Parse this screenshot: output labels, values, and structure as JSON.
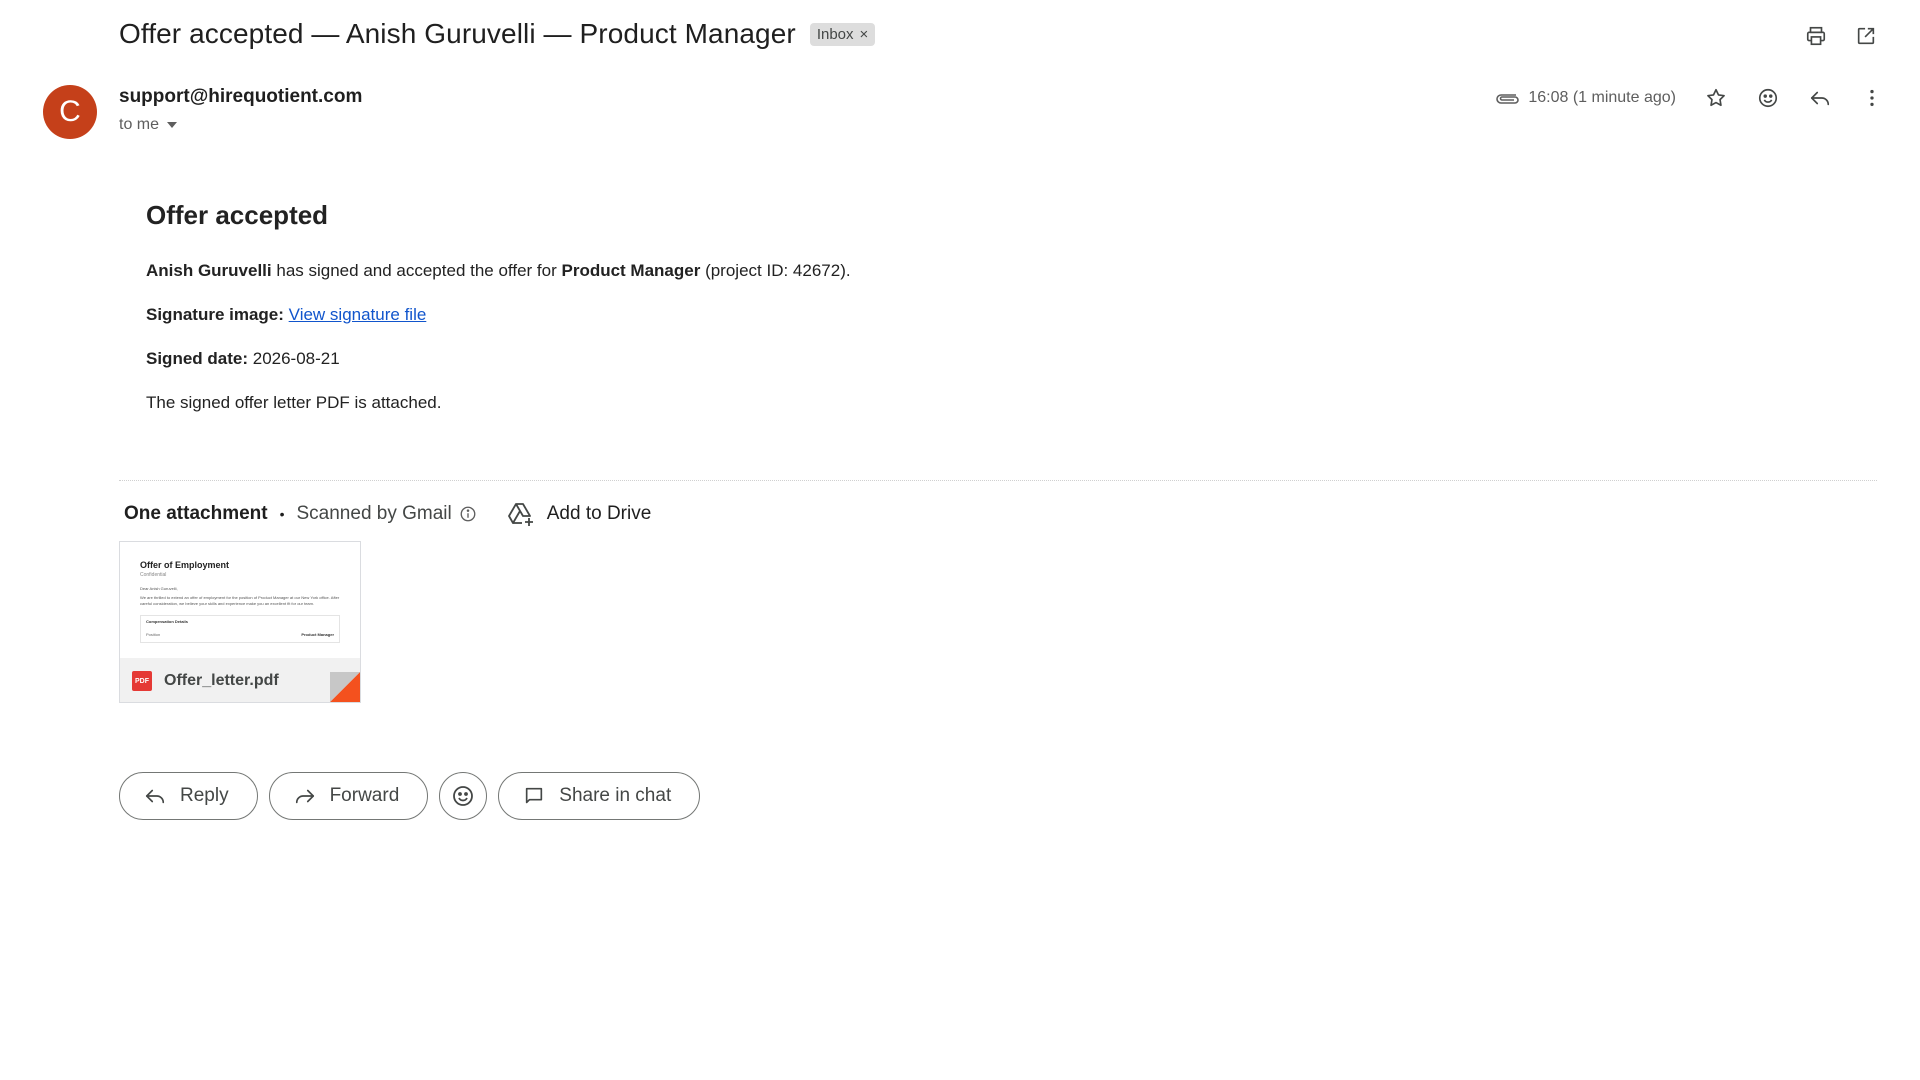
{
  "email": {
    "subject": "Offer accepted — Anish Guruvelli — Product Manager",
    "label": "Inbox",
    "label_remove": "×",
    "avatar_letter": "C",
    "avatar_color": "#c5401a",
    "sender": "support@hirequotient.com",
    "recipient": "to me",
    "timestamp": "16:08 (1 minute ago)"
  },
  "body": {
    "heading": "Offer accepted",
    "candidate": "Anish Guruvelli",
    "line1_mid": " has signed and accepted the offer for ",
    "role": "Product Manager",
    "line1_end": " (project ID: 42672).",
    "signature_label": "Signature image:",
    "signature_link": "View signature file",
    "date_label": "Signed date:",
    "date_value": " 2026-08-21",
    "closing": "The signed offer letter PDF is attached."
  },
  "attachments": {
    "count_label": "One attachment",
    "separator": "•",
    "scanned": "Scanned by Gmail",
    "add_to_drive": "Add to Drive",
    "file_name": "Offer_letter.pdf",
    "file_type": "PDF",
    "preview": {
      "title": "Offer of Employment",
      "subtitle": "Confidential",
      "greeting": "Dear Anish Guruvelli,",
      "text": "We are thrilled to extend an offer of employment for the position of Product Manager at our New York office. After careful consideration, we believe your skills and experience make you an excellent fit for our team.",
      "box_heading": "Compensation Details",
      "row_left": "Position",
      "row_right": "Product Manager"
    }
  },
  "actions": {
    "reply": "Reply",
    "forward": "Forward",
    "share": "Share in chat"
  },
  "colors": {
    "link": "#1155cc",
    "pdf_red": "#e53935"
  }
}
